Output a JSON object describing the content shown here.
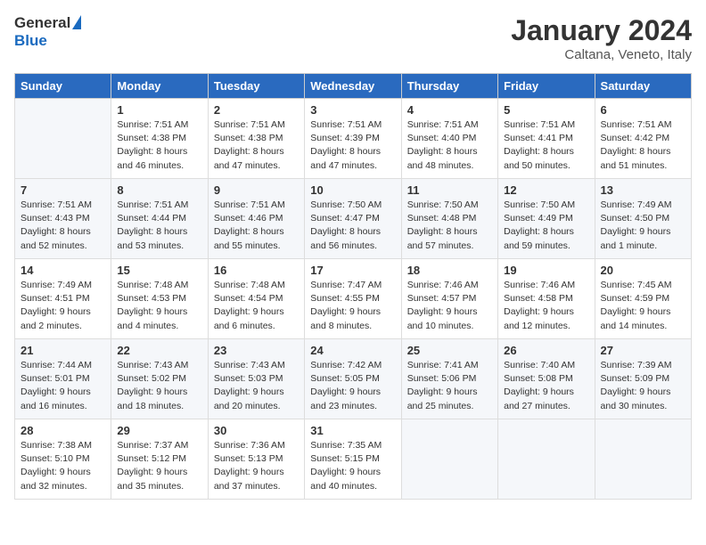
{
  "header": {
    "logo_general": "General",
    "logo_blue": "Blue",
    "month_title": "January 2024",
    "location": "Caltana, Veneto, Italy"
  },
  "weekdays": [
    "Sunday",
    "Monday",
    "Tuesday",
    "Wednesday",
    "Thursday",
    "Friday",
    "Saturday"
  ],
  "weeks": [
    [
      {
        "day": "",
        "info": ""
      },
      {
        "day": "1",
        "info": "Sunrise: 7:51 AM\nSunset: 4:38 PM\nDaylight: 8 hours\nand 46 minutes."
      },
      {
        "day": "2",
        "info": "Sunrise: 7:51 AM\nSunset: 4:38 PM\nDaylight: 8 hours\nand 47 minutes."
      },
      {
        "day": "3",
        "info": "Sunrise: 7:51 AM\nSunset: 4:39 PM\nDaylight: 8 hours\nand 47 minutes."
      },
      {
        "day": "4",
        "info": "Sunrise: 7:51 AM\nSunset: 4:40 PM\nDaylight: 8 hours\nand 48 minutes."
      },
      {
        "day": "5",
        "info": "Sunrise: 7:51 AM\nSunset: 4:41 PM\nDaylight: 8 hours\nand 50 minutes."
      },
      {
        "day": "6",
        "info": "Sunrise: 7:51 AM\nSunset: 4:42 PM\nDaylight: 8 hours\nand 51 minutes."
      }
    ],
    [
      {
        "day": "7",
        "info": "Sunrise: 7:51 AM\nSunset: 4:43 PM\nDaylight: 8 hours\nand 52 minutes."
      },
      {
        "day": "8",
        "info": "Sunrise: 7:51 AM\nSunset: 4:44 PM\nDaylight: 8 hours\nand 53 minutes."
      },
      {
        "day": "9",
        "info": "Sunrise: 7:51 AM\nSunset: 4:46 PM\nDaylight: 8 hours\nand 55 minutes."
      },
      {
        "day": "10",
        "info": "Sunrise: 7:50 AM\nSunset: 4:47 PM\nDaylight: 8 hours\nand 56 minutes."
      },
      {
        "day": "11",
        "info": "Sunrise: 7:50 AM\nSunset: 4:48 PM\nDaylight: 8 hours\nand 57 minutes."
      },
      {
        "day": "12",
        "info": "Sunrise: 7:50 AM\nSunset: 4:49 PM\nDaylight: 8 hours\nand 59 minutes."
      },
      {
        "day": "13",
        "info": "Sunrise: 7:49 AM\nSunset: 4:50 PM\nDaylight: 9 hours\nand 1 minute."
      }
    ],
    [
      {
        "day": "14",
        "info": "Sunrise: 7:49 AM\nSunset: 4:51 PM\nDaylight: 9 hours\nand 2 minutes."
      },
      {
        "day": "15",
        "info": "Sunrise: 7:48 AM\nSunset: 4:53 PM\nDaylight: 9 hours\nand 4 minutes."
      },
      {
        "day": "16",
        "info": "Sunrise: 7:48 AM\nSunset: 4:54 PM\nDaylight: 9 hours\nand 6 minutes."
      },
      {
        "day": "17",
        "info": "Sunrise: 7:47 AM\nSunset: 4:55 PM\nDaylight: 9 hours\nand 8 minutes."
      },
      {
        "day": "18",
        "info": "Sunrise: 7:46 AM\nSunset: 4:57 PM\nDaylight: 9 hours\nand 10 minutes."
      },
      {
        "day": "19",
        "info": "Sunrise: 7:46 AM\nSunset: 4:58 PM\nDaylight: 9 hours\nand 12 minutes."
      },
      {
        "day": "20",
        "info": "Sunrise: 7:45 AM\nSunset: 4:59 PM\nDaylight: 9 hours\nand 14 minutes."
      }
    ],
    [
      {
        "day": "21",
        "info": "Sunrise: 7:44 AM\nSunset: 5:01 PM\nDaylight: 9 hours\nand 16 minutes."
      },
      {
        "day": "22",
        "info": "Sunrise: 7:43 AM\nSunset: 5:02 PM\nDaylight: 9 hours\nand 18 minutes."
      },
      {
        "day": "23",
        "info": "Sunrise: 7:43 AM\nSunset: 5:03 PM\nDaylight: 9 hours\nand 20 minutes."
      },
      {
        "day": "24",
        "info": "Sunrise: 7:42 AM\nSunset: 5:05 PM\nDaylight: 9 hours\nand 23 minutes."
      },
      {
        "day": "25",
        "info": "Sunrise: 7:41 AM\nSunset: 5:06 PM\nDaylight: 9 hours\nand 25 minutes."
      },
      {
        "day": "26",
        "info": "Sunrise: 7:40 AM\nSunset: 5:08 PM\nDaylight: 9 hours\nand 27 minutes."
      },
      {
        "day": "27",
        "info": "Sunrise: 7:39 AM\nSunset: 5:09 PM\nDaylight: 9 hours\nand 30 minutes."
      }
    ],
    [
      {
        "day": "28",
        "info": "Sunrise: 7:38 AM\nSunset: 5:10 PM\nDaylight: 9 hours\nand 32 minutes."
      },
      {
        "day": "29",
        "info": "Sunrise: 7:37 AM\nSunset: 5:12 PM\nDaylight: 9 hours\nand 35 minutes."
      },
      {
        "day": "30",
        "info": "Sunrise: 7:36 AM\nSunset: 5:13 PM\nDaylight: 9 hours\nand 37 minutes."
      },
      {
        "day": "31",
        "info": "Sunrise: 7:35 AM\nSunset: 5:15 PM\nDaylight: 9 hours\nand 40 minutes."
      },
      {
        "day": "",
        "info": ""
      },
      {
        "day": "",
        "info": ""
      },
      {
        "day": "",
        "info": ""
      }
    ]
  ]
}
